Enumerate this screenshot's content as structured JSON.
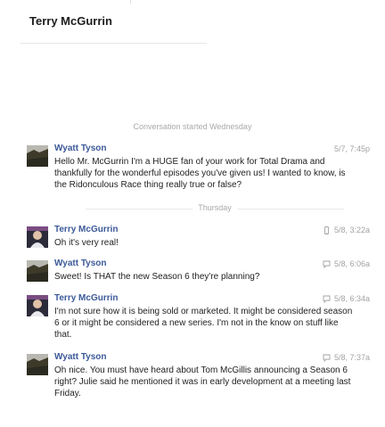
{
  "header": {
    "contact_name": "Terry McGurrin"
  },
  "conversation": {
    "started_label": "Conversation started Wednesday",
    "day_divider": "Thursday",
    "messages": [
      {
        "sender": "Wyatt Tyson",
        "time": "5/7, 7:45p",
        "text": "Hello Mr. McGurrin I'm a HUGE fan of your work for Total Drama and thankfully for the wonderful episodes you've given us! I wanted to know, is the Ridonculous Race thing really true or false?",
        "meta_icon": "none"
      },
      {
        "sender": "Terry McGurrin",
        "time": "5/8, 3:22a",
        "text": "Oh it's very real!",
        "meta_icon": "mobile-icon"
      },
      {
        "sender": "Wyatt Tyson",
        "time": "5/8, 6:06a",
        "text": "Sweet! Is THAT the new Season 6 they're planning?",
        "meta_icon": "chat-icon"
      },
      {
        "sender": "Terry McGurrin",
        "time": "5/8, 6:34a",
        "text": "I'm not sure how it is being sold or marketed. It might be considered season 6 or it might be considered a new series. I'm not in the know on stuff like that.",
        "meta_icon": "chat-icon"
      },
      {
        "sender": "Wyatt Tyson",
        "time": "5/8, 7:37a",
        "text": "Oh nice. You must have heard about Tom McGillis announcing a Season 6 right? Julie said he mentioned it was in early development at a meeting last Friday.",
        "meta_icon": "chat-icon"
      }
    ]
  }
}
